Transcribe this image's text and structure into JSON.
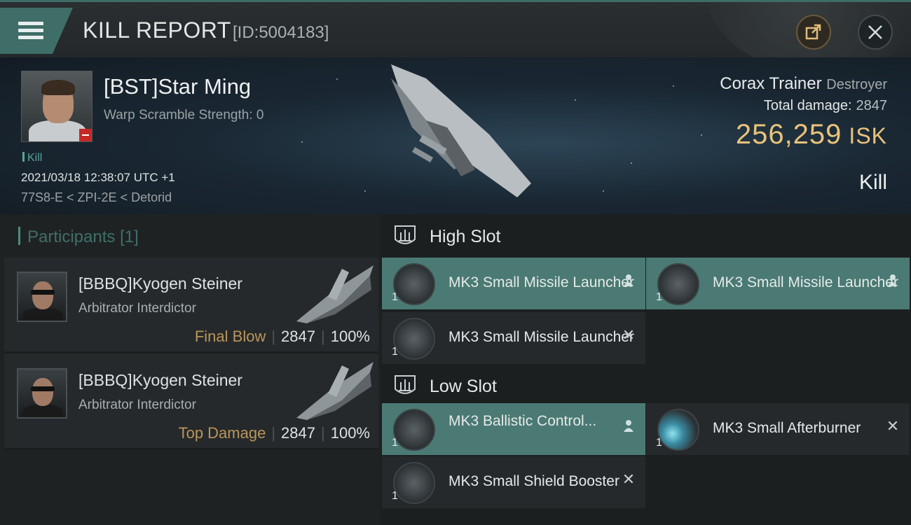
{
  "header": {
    "title": "KILL REPORT",
    "id": "[ID:5004183]",
    "icons": {
      "menu": "menu-icon",
      "share": "share-icon",
      "close": "close-icon"
    }
  },
  "victim": {
    "name": "[BST]Star Ming",
    "warp_scramble": "Warp Scramble Strength: 0",
    "kill_tag": "Kill",
    "datetime": "2021/03/18 12:38:07 UTC +1",
    "location": "77S8-E < ZPI-2E < Detorid",
    "ship_name": "Corax Trainer",
    "ship_class": "Destroyer",
    "total_damage_label": "Total damage:",
    "total_damage": "2847",
    "isk_value": "256,259",
    "isk_unit": "ISK",
    "result": "Kill"
  },
  "participants": {
    "title": "Participants",
    "count": "[1]",
    "rows": [
      {
        "name": "[BBBQ]Kyogen Steiner",
        "ship": "Arbitrator Interdictor",
        "tag": "Final Blow",
        "damage": "2847",
        "percent": "100%"
      },
      {
        "name": "[BBBQ]Kyogen Steiner",
        "ship": "Arbitrator Interdictor",
        "tag": "Top Damage",
        "damage": "2847",
        "percent": "100%"
      }
    ]
  },
  "fittings": {
    "high_slot_label": "High Slot",
    "low_slot_label": "Low Slot",
    "high": [
      {
        "name": "MK3 Small Missile Launcher",
        "qty": "1",
        "status": "dropped"
      },
      {
        "name": "MK3 Small Missile Launcher",
        "qty": "1",
        "status": "dropped"
      },
      {
        "name": "MK3 Small Missile Launcher",
        "qty": "1",
        "status": "destroyed"
      }
    ],
    "low": [
      {
        "name": "MK3 Ballistic Control...",
        "qty": "1",
        "status": "dropped"
      },
      {
        "name": "MK3 Small Afterburner",
        "qty": "1",
        "status": "destroyed"
      },
      {
        "name": "MK3 Small Shield Booster",
        "qty": "1",
        "status": "destroyed"
      }
    ]
  },
  "colors": {
    "accent": "#4a7a73",
    "isk": "#e9c37b",
    "tag": "#b9955b"
  }
}
